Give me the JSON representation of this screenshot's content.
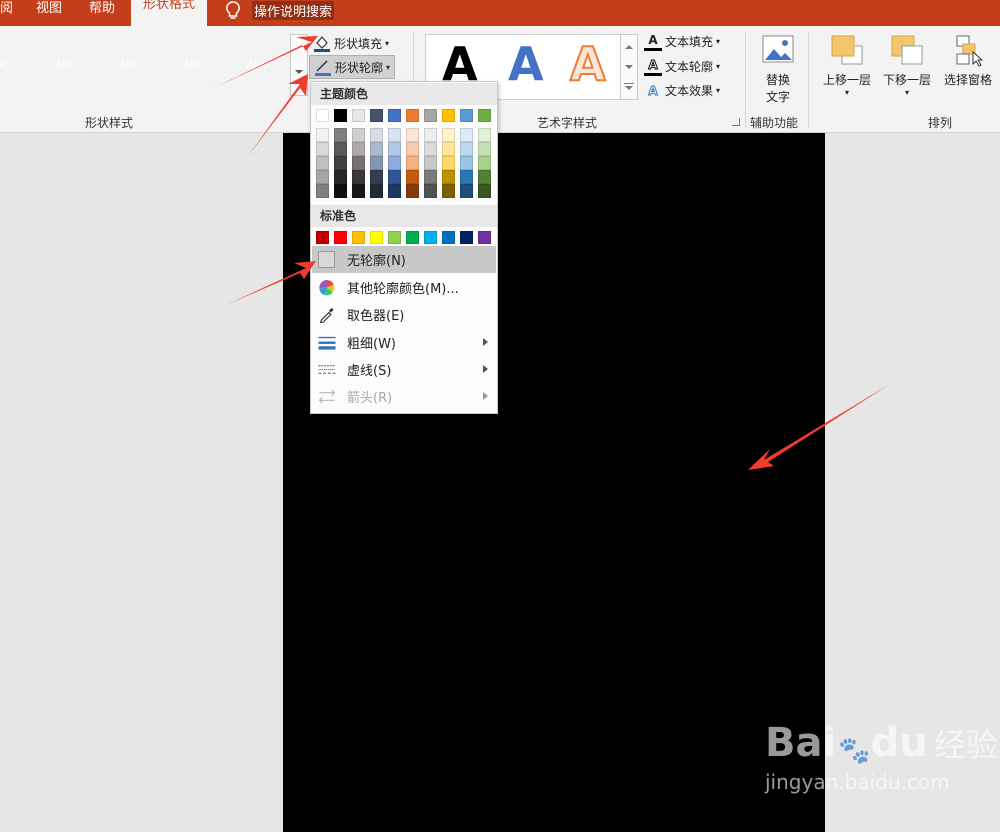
{
  "tabs": [
    "阅",
    "视图",
    "帮助",
    "形状格式"
  ],
  "tell_me": "操作说明搜索",
  "shape_styles": {
    "group_label": "形状样式",
    "thumbs": [
      {
        "label": "bc",
        "color": "#ed7d31"
      },
      {
        "label": "Abc",
        "color": "#a5a5a5"
      },
      {
        "label": "Abc",
        "color": "#ffc000"
      },
      {
        "label": "Abc",
        "color": "#5b9bd5"
      },
      {
        "label": "Abc",
        "color": "#70ad47"
      }
    ],
    "fill_label": "形状填充",
    "outline_label": "形状轮廓"
  },
  "wordart": {
    "group_label": "艺术字样式",
    "letter": "A",
    "text_fill": "文本填充",
    "text_outline": "文本轮廓",
    "text_effects": "文本效果"
  },
  "accessibility": {
    "group_label": "辅助功能",
    "alt_text_1": "替换",
    "alt_text_2": "文字"
  },
  "arrange": {
    "group_label": "排列",
    "bring_forward": "上移一层",
    "send_backward": "下移一层",
    "selection_pane": "选择窗格"
  },
  "menu": {
    "theme_colors_label": "主题颜色",
    "standard_colors_label": "标准色",
    "theme_top": [
      "#ffffff",
      "#000000",
      "#e7e6e6",
      "#44546a",
      "#4472c4",
      "#ed7d31",
      "#a5a5a5",
      "#ffc000",
      "#5b9bd5",
      "#70ad47"
    ],
    "theme_shades": [
      [
        "#f2f2f2",
        "#d9d9d9",
        "#bfbfbf",
        "#a6a6a6",
        "#808080"
      ],
      [
        "#808080",
        "#595959",
        "#404040",
        "#262626",
        "#0d0d0d"
      ],
      [
        "#d0cece",
        "#aeaaaa",
        "#767171",
        "#3b3838",
        "#171616"
      ],
      [
        "#d6dce5",
        "#adb9ca",
        "#8497b0",
        "#333f50",
        "#222a35"
      ],
      [
        "#d9e2f3",
        "#b4c7e7",
        "#8faadc",
        "#2f5597",
        "#1f3864"
      ],
      [
        "#fbe5d6",
        "#f8cbad",
        "#f4b183",
        "#c55a11",
        "#843c0c"
      ],
      [
        "#ededed",
        "#dbdbdb",
        "#c9c9c9",
        "#7b7b7b",
        "#525252"
      ],
      [
        "#fff2cc",
        "#ffe699",
        "#ffd966",
        "#bf9000",
        "#7f6000"
      ],
      [
        "#deebf7",
        "#bdd7ee",
        "#9dc3e6",
        "#2e75b6",
        "#1f4e79"
      ],
      [
        "#e2f0d9",
        "#c5e0b4",
        "#a9d18e",
        "#548235",
        "#385723"
      ]
    ],
    "standard": [
      "#c00000",
      "#ff0000",
      "#ffc000",
      "#ffff00",
      "#92d050",
      "#00b050",
      "#00b0f0",
      "#0070c0",
      "#002060",
      "#7030a0"
    ],
    "items": [
      {
        "label": "无轮廓(N)",
        "icon": "no-outline-icon"
      },
      {
        "label": "其他轮廓颜色(M)...",
        "icon": "color-wheel-icon"
      },
      {
        "label": "取色器(E)",
        "icon": "eyedropper-icon"
      },
      {
        "label": "粗细(W)",
        "icon": "weight-icon"
      },
      {
        "label": "虚线(S)",
        "icon": "dashes-icon"
      },
      {
        "label": "箭头(R)",
        "icon": "arrows-icon"
      }
    ]
  },
  "watermark": {
    "brand": "Bai",
    "brand2": "du",
    "cn": "经验",
    "url": "jingyan.baidu.com"
  }
}
